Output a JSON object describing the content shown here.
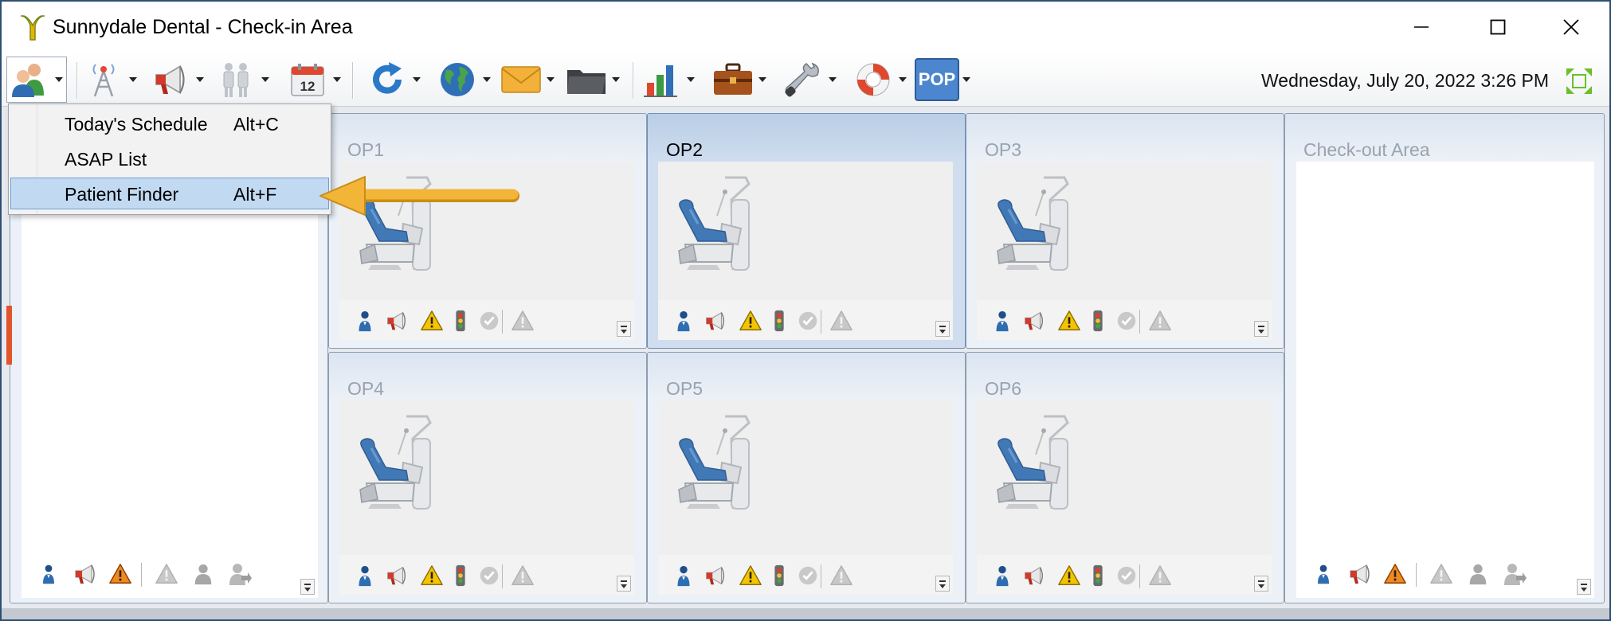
{
  "window": {
    "title": "Sunnydale Dental - Check-in Area",
    "controls": [
      "minimize-icon",
      "maximize-icon",
      "close-icon"
    ]
  },
  "toolbar": {
    "items": [
      {
        "icon": "patients-icon",
        "has_dropdown": true
      },
      {
        "icon": "radio-tower-icon",
        "has_dropdown": true
      },
      {
        "icon": "megaphone-icon",
        "has_dropdown": true
      },
      {
        "icon": "staff-icon",
        "has_dropdown": true
      },
      {
        "icon": "calendar-icon",
        "label": "12",
        "has_dropdown": true
      },
      {
        "icon": "refresh-icon",
        "has_dropdown": true
      },
      {
        "icon": "globe-icon",
        "has_dropdown": true
      },
      {
        "icon": "mail-icon",
        "has_dropdown": true
      },
      {
        "icon": "folder-icon",
        "has_dropdown": true
      },
      {
        "icon": "bar-chart-icon",
        "has_dropdown": true
      },
      {
        "icon": "briefcase-icon",
        "has_dropdown": true
      },
      {
        "icon": "wrench-icon",
        "has_dropdown": true
      },
      {
        "icon": "lifebuoy-icon",
        "has_dropdown": true
      },
      {
        "icon": "pop-icon",
        "label": "POP",
        "has_dropdown": true
      }
    ],
    "datetime": "Wednesday, July 20, 2022 3:26 PM",
    "view_toggle_icon": "grid-view-icon"
  },
  "menu": {
    "items": [
      {
        "label": "Today's Schedule",
        "shortcut": "Alt+C",
        "highlighted": false
      },
      {
        "label": "ASAP List",
        "shortcut": "",
        "highlighted": false
      },
      {
        "label": "Patient Finder",
        "shortcut": "Alt+F",
        "highlighted": true
      }
    ],
    "callout": "arrow-pointer-icon"
  },
  "areas": {
    "checkin": {
      "label": ""
    },
    "checkout": {
      "label": "Check-out Area"
    },
    "ops": [
      {
        "label": "OP1",
        "selected": false
      },
      {
        "label": "OP2",
        "selected": true
      },
      {
        "label": "OP3",
        "selected": false
      },
      {
        "label": "OP4",
        "selected": false
      },
      {
        "label": "OP5",
        "selected": false
      },
      {
        "label": "OP6",
        "selected": false
      }
    ]
  },
  "op_tools": [
    "patient-icon",
    "megaphone-icon",
    "warning-icon",
    "traffic-light-icon",
    "check-circle-icon",
    "alert-gray-icon"
  ],
  "side_tools": [
    "patient-icon",
    "megaphone-icon",
    "warning-icon",
    "alert-gray-icon",
    "person-gray-icon",
    "move-person-icon"
  ],
  "colors": {
    "selected_panel": "#b9cee6",
    "menu_highlight": "#c2d9f2",
    "callout_arrow": "#f0b433",
    "left_marker": "#e2542b"
  }
}
